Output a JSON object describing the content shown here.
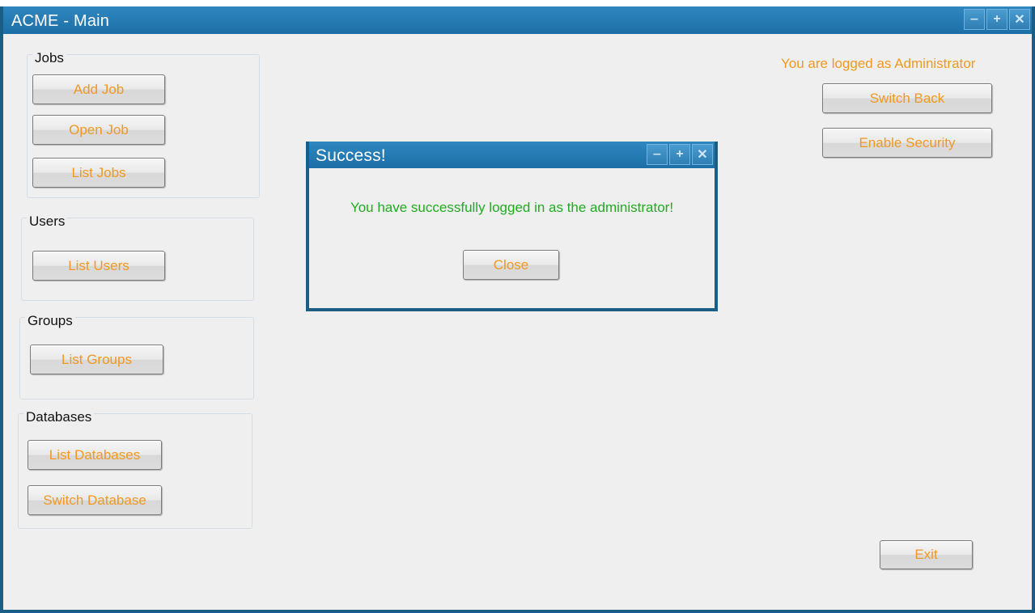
{
  "window": {
    "title": "ACME - Main",
    "controls": [
      "minimize-icon",
      "maximize-icon",
      "close-icon"
    ]
  },
  "groups": {
    "jobs": {
      "label": "Jobs",
      "buttons": [
        "Add Job",
        "Open Job",
        "List Jobs"
      ]
    },
    "users": {
      "label": "Users",
      "buttons": [
        "List Users"
      ]
    },
    "groups": {
      "label": "Groups",
      "buttons": [
        "List Groups"
      ]
    },
    "databases": {
      "label": "Databases",
      "buttons": [
        "List Databases",
        "Switch Database"
      ]
    }
  },
  "account": {
    "status_text": "You are logged as Administrator",
    "switch_back_label": "Switch Back",
    "enable_security_label": "Enable Security"
  },
  "exit_label": "Exit",
  "dialog": {
    "title": "Success!",
    "message": "You have successfully logged in as the administrator!",
    "close_label": "Close"
  },
  "colors": {
    "titlebar": "#2a80b8",
    "border": "#1a5e86",
    "button_text": "#f09820",
    "success_text": "#22aa22",
    "background": "#efefef"
  }
}
